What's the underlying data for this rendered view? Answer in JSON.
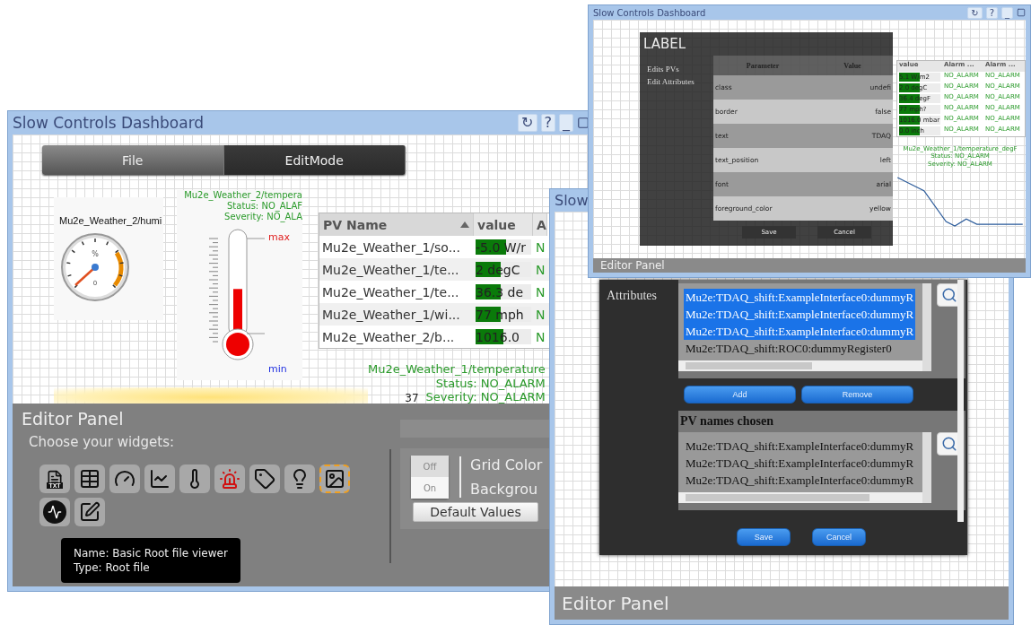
{
  "main_window": {
    "title": "Slow Controls Dashboard",
    "title_buttons": [
      "↻",
      "?",
      "_"
    ],
    "menu": [
      {
        "label": "File",
        "selected": false
      },
      {
        "label": "EditMode",
        "selected": true
      }
    ],
    "gauge": {
      "title": "Mu2e_Weather_2/humi",
      "unit": "%",
      "scale_min": "0"
    },
    "thermometer": {
      "title": "Mu2e_Weather_2/tempera",
      "status": "Status: NO_ALAF",
      "severity": "Severity: NO_ALA",
      "max": "max",
      "min": "min",
      "level": 0.45
    },
    "pv_table": {
      "columns": [
        {
          "label": "PV Name",
          "sorted": true
        },
        {
          "label": "value",
          "sorted": false
        },
        {
          "label": "A",
          "sorted": false
        }
      ],
      "rows": [
        {
          "name": "Mu2e_Weather_1/so...",
          "value": "-5.0 W/r",
          "alarm": "N",
          "level": 0.55
        },
        {
          "name": "Mu2e_Weather_1/te...",
          "value": "2 degC",
          "alarm": "N",
          "level": 0.45
        },
        {
          "name": "Mu2e_Weather_1/te...",
          "value": "36.3 de",
          "alarm": "N",
          "level": 0.45
        },
        {
          "name": "Mu2e_Weather_1/wi...",
          "value": "77 mph",
          "alarm": "N",
          "level": 0.45
        },
        {
          "name": "Mu2e_Weather_2/b...",
          "value": "1016.0",
          "alarm": "N",
          "level": 0.5
        }
      ]
    },
    "trend": {
      "title": "Mu2e_Weather_1/temperature",
      "status": "Status: NO_ALARM",
      "severity": "Severity: NO_ALARM",
      "reading": "37"
    },
    "editor": {
      "title": "Editor Panel",
      "prompt": "Choose your widgets:",
      "widgets": [
        {
          "kind": "text",
          "label": "TXT",
          "selected": false
        },
        {
          "kind": "table",
          "selected": false
        },
        {
          "kind": "gauge",
          "selected": false
        },
        {
          "kind": "chart",
          "selected": false
        },
        {
          "kind": "thermometer",
          "selected": false
        },
        {
          "kind": "alarm",
          "selected": false
        },
        {
          "kind": "tag",
          "selected": false
        },
        {
          "kind": "led",
          "selected": false
        },
        {
          "kind": "image",
          "selected": true
        },
        {
          "kind": "root",
          "selected": false
        },
        {
          "kind": "edit",
          "selected": false
        }
      ],
      "tooltip": [
        "Name: Basic Root file viewer",
        "Type: Root file"
      ],
      "toggle": [
        {
          "label": "Off",
          "selected": true
        },
        {
          "label": "On",
          "selected": false
        }
      ],
      "settings": [
        "Grid Color",
        "Backgrou"
      ],
      "default_button": "Default Values"
    }
  },
  "pv_window": {
    "title": "Slow",
    "sidebar": [
      "Attributes"
    ],
    "available": [
      {
        "name": "Mu2e:TDAQ_shift:ExampleInterface0:dummyR",
        "selected": true
      },
      {
        "name": "Mu2e:TDAQ_shift:ExampleInterface0:dummyR",
        "selected": true
      },
      {
        "name": "Mu2e:TDAQ_shift:ExampleInterface0:dummyR",
        "selected": true
      },
      {
        "name": "Mu2e:TDAQ_shift:ROC0:dummyRegister0",
        "selected": false
      }
    ],
    "buttons": [
      "Add",
      "Remove"
    ],
    "chosen_title": "PV names chosen",
    "chosen": [
      "Mu2e:TDAQ_shift:ExampleInterface0:dummyR",
      "Mu2e:TDAQ_shift:ExampleInterface0:dummyR",
      "Mu2e:TDAQ_shift:ExampleInterface0:dummyR"
    ],
    "actions": [
      "Save",
      "Cancel"
    ],
    "footer": "Editor Panel"
  },
  "label_window": {
    "title": "Slow Controls Dashboard",
    "title_buttons": [
      "↻",
      "?",
      "_"
    ],
    "background_table": {
      "columns": [
        "value",
        "Alarm ...",
        "Alarm ..."
      ],
      "rows": [
        {
          "value": "5.1 W/m2",
          "alarm_1": "NO_ALARM",
          "alarm_2": "NO_ALARM",
          "level": 0.5
        },
        {
          "value": "2.0 degC",
          "alarm_1": "NO_ALARM",
          "alarm_2": "NO_ALARM",
          "level": 0.5
        },
        {
          "value": "36.4 degF",
          "alarm_1": "NO_ALARM",
          "alarm_2": "NO_ALARM",
          "level": 0.5
        },
        {
          "value": "77 mph?",
          "alarm_1": "NO_ALARM",
          "alarm_2": "NO_ALARM",
          "level": 0.5
        },
        {
          "value": "1016.0 mbar",
          "alarm_1": "NO_ALARM",
          "alarm_2": "NO_ALARM",
          "level": 0.5
        },
        {
          "value": "0.0 inch",
          "alarm_1": "NO_ALARM",
          "alarm_2": "NO_ALARM",
          "level": 0.5
        }
      ]
    },
    "trend": {
      "title": "Mu2e_Weather_1/temperature_degF",
      "status": "Status: NO_ALARM",
      "severity": "Severity: NO_ALARM"
    },
    "dialog": {
      "title": "LABEL",
      "sidebar": [
        "Edits PVs",
        "Edit Attributes"
      ],
      "columns": [
        "Parameter",
        "Value"
      ],
      "rows": [
        {
          "parameter": "class",
          "value": "undefi"
        },
        {
          "parameter": "border",
          "value": "false"
        },
        {
          "parameter": "text",
          "value": "TDAQ"
        },
        {
          "parameter": "text_position",
          "value": "left"
        },
        {
          "parameter": "font",
          "value": "arial"
        },
        {
          "parameter": "foreground_color",
          "value": "yellow"
        }
      ],
      "actions": [
        "Save",
        "Cancel"
      ]
    },
    "footer": "Editor Panel"
  }
}
